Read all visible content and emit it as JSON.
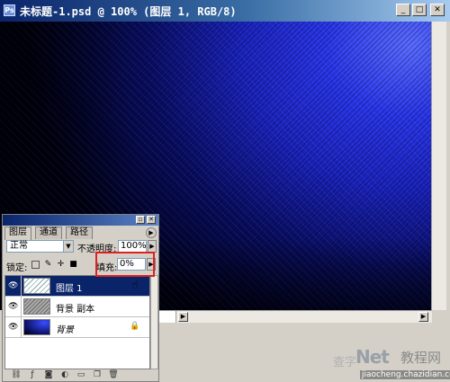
{
  "document": {
    "title": "未标题-1.psd @ 100% (图层 1, RGB/8)",
    "app_icon_glyph": "Ps",
    "buttons": {
      "minimize": "_",
      "maximize": "□",
      "close": "✕"
    }
  },
  "layers_panel": {
    "tabs": [
      {
        "label": "图层",
        "active": true
      },
      {
        "label": "通道",
        "active": false
      },
      {
        "label": "路径",
        "active": false
      }
    ],
    "blend_mode": "正常",
    "opacity_label": "不透明度:",
    "opacity_value": "100%",
    "lock_label": "锁定:",
    "fill_label": "填充:",
    "fill_value": "0%",
    "layers": [
      {
        "name": "图层 1",
        "selected": true,
        "visible": true,
        "locked": false,
        "italic": false
      },
      {
        "name": "背景 副本",
        "selected": false,
        "visible": true,
        "locked": false,
        "italic": false
      },
      {
        "name": "背景",
        "selected": false,
        "visible": true,
        "locked": true,
        "italic": true
      }
    ]
  },
  "watermark": {
    "logo": "Net",
    "cn_text": "教程网",
    "left_char": "查字",
    "url": "jiaocheng.chazidian.com"
  },
  "colors": {
    "title_bar": "#0a246a",
    "selection": "#0a246a",
    "highlight": "#e02020",
    "canvas_blue": "#2a36e8"
  }
}
